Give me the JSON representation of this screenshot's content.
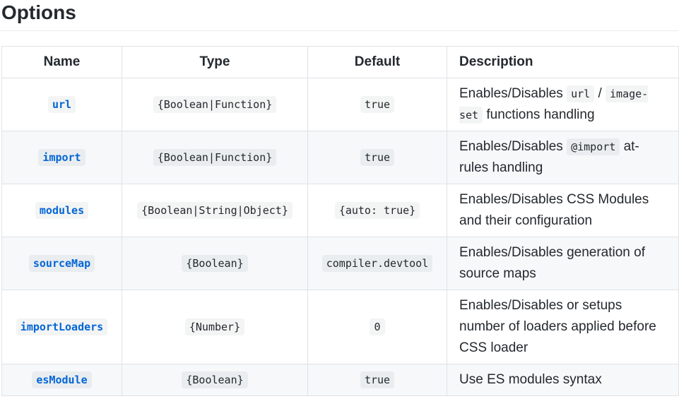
{
  "heading": "Options",
  "columns": {
    "name": "Name",
    "type": "Type",
    "default": "Default",
    "description": "Description"
  },
  "rows": [
    {
      "name": "url",
      "type": "{Boolean|Function}",
      "default": "true",
      "desc_pre": "Enables/Disables ",
      "desc_code1": "url",
      "desc_mid": " / ",
      "desc_code2": "image-set",
      "desc_post": " functions handling"
    },
    {
      "name": "import",
      "type": "{Boolean|Function}",
      "default": "true",
      "desc_pre": "Enables/Disables ",
      "desc_code1": "@import",
      "desc_post": " at-rules handling"
    },
    {
      "name": "modules",
      "type": "{Boolean|String|Object}",
      "default": "{auto: true}",
      "desc": "Enables/Disables CSS Modules and their configuration"
    },
    {
      "name": "sourceMap",
      "type": "{Boolean}",
      "default": "compiler.devtool",
      "desc": "Enables/Disables generation of source maps"
    },
    {
      "name": "importLoaders",
      "type": "{Number}",
      "default": "0",
      "desc": "Enables/Disables or setups number of loaders applied before CSS loader"
    },
    {
      "name": "esModule",
      "type": "{Boolean}",
      "default": "true",
      "desc": "Use ES modules syntax"
    }
  ]
}
